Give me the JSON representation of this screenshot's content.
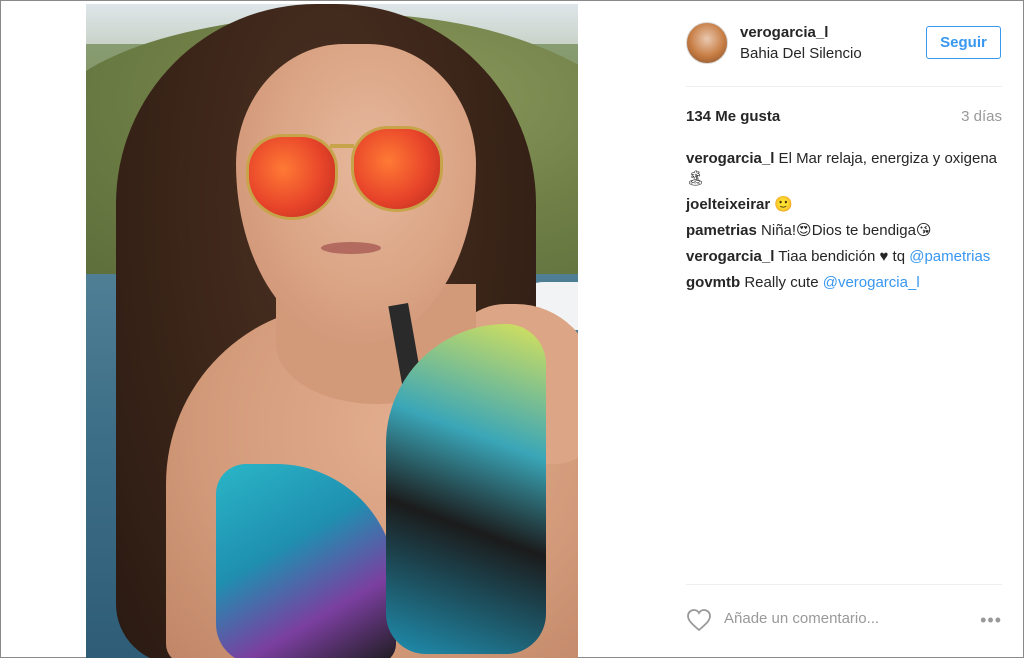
{
  "post": {
    "username": "verogarcia_l",
    "location": "Bahia Del Silencio",
    "follow_label": "Seguir",
    "likes": "134 Me gusta",
    "time": "3 días"
  },
  "comments": [
    {
      "user": "verogarcia_l",
      "text": " El Mar relaja, energiza y oxigena🏝",
      "mention": ""
    },
    {
      "user": "joelteixeirar",
      "text": " 🙂",
      "mention": ""
    },
    {
      "user": "pametrias",
      "text": " Niña!😍Dios te bendiga😘",
      "mention": ""
    },
    {
      "user": "verogarcia_l",
      "text": " Tiaa bendición ♥ tq ",
      "mention": "@pametrias"
    },
    {
      "user": "govmtb",
      "text": " Really cute ",
      "mention": "@verogarcia_l"
    }
  ],
  "footer": {
    "comment_placeholder": "Añade un comentario...",
    "more_icon": "…"
  },
  "icons": {
    "like": "heart-outline-icon",
    "more": "ellipsis-icon"
  },
  "colors": {
    "accent": "#3897f0",
    "muted": "#999999",
    "text": "#262626"
  }
}
